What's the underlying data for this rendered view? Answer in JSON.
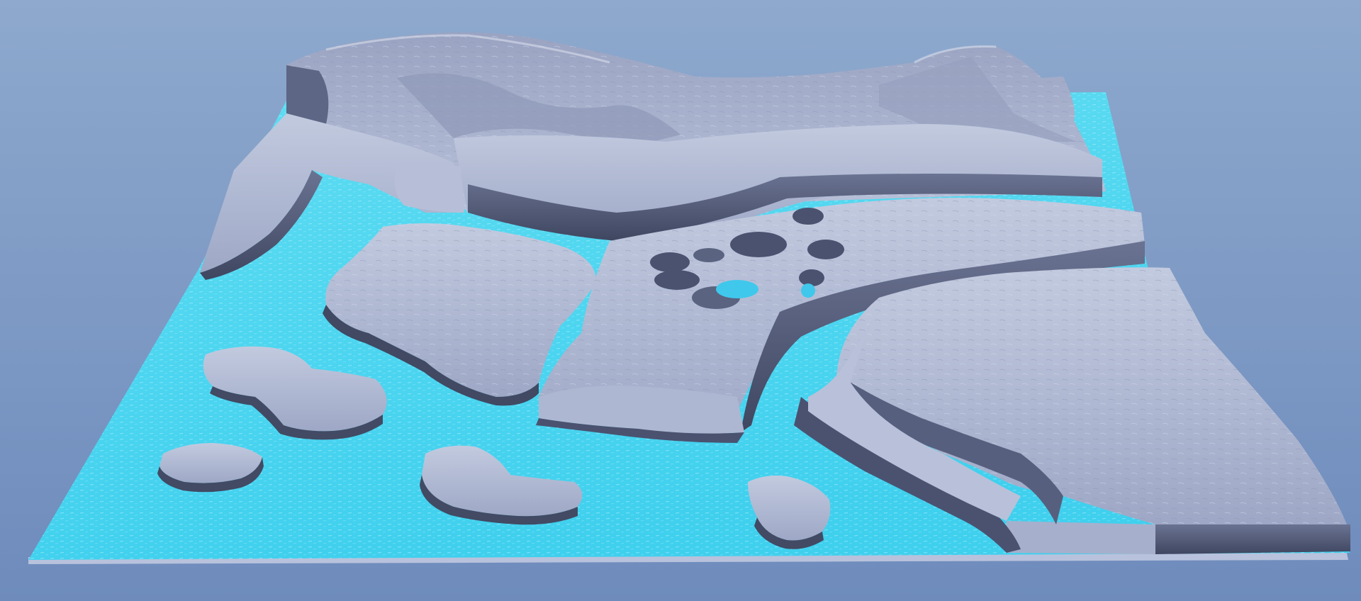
{
  "scene": {
    "subject": "terrain-relief-render",
    "colors": {
      "sky_top": "#8ea9cd",
      "sky_bottom": "#6e8bbc",
      "water": "#3fd2ee",
      "water_light": "#7fe6f7",
      "water_deep": "#2b9fd8",
      "rock_top": "#a9b3cf",
      "rock_light": "#c2cadf",
      "rock_shadow": "#5a6380",
      "rock_dark": "#3f4660",
      "base_plate": "#9aa4c2"
    }
  }
}
